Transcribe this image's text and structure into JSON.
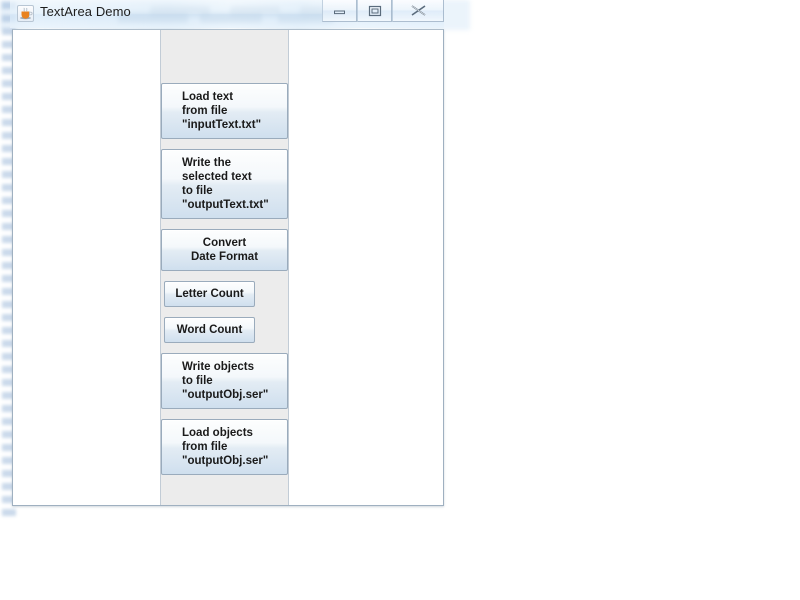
{
  "window": {
    "title": "TextArea Demo",
    "app_icon": "java-coffee-cup-icon",
    "controls": {
      "minimize": "minimize-button",
      "maximize": "maximize-button",
      "close": "close-button"
    }
  },
  "panes": {
    "left_textarea_value": "",
    "right_textarea_value": ""
  },
  "buttons": [
    {
      "name": "load-text-from-file-button",
      "lines": [
        "Load text",
        "from file",
        "\"inputText.txt\""
      ],
      "style": "wide"
    },
    {
      "name": "write-selected-text-to-file-button",
      "lines": [
        "Write the",
        "selected text",
        "to file",
        "\"outputText.txt\""
      ],
      "style": "wide"
    },
    {
      "name": "convert-date-format-button",
      "lines": [
        "Convert",
        "Date Format"
      ],
      "style": "wide-centered"
    },
    {
      "name": "letter-count-button",
      "lines": [
        "Letter Count"
      ],
      "style": "small"
    },
    {
      "name": "word-count-button",
      "lines": [
        "Word Count"
      ],
      "style": "small"
    },
    {
      "name": "write-objects-to-file-button",
      "lines": [
        "Write objects",
        "to file",
        "\"outputObj.ser\""
      ],
      "style": "wide"
    },
    {
      "name": "load-objects-from-file-button",
      "lines": [
        "Load objects",
        "from file",
        "\"outputObj.ser\""
      ],
      "style": "wide"
    }
  ],
  "colors": {
    "button_pane_bg": "#ececec",
    "button_border": "#9aablc",
    "titlebar_tint": "#dcebf8",
    "frame_border": "#9fb0c0"
  }
}
